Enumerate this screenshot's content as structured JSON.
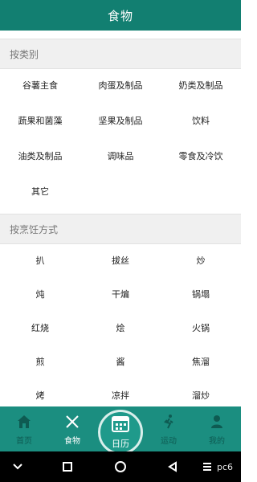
{
  "header": {
    "title": "食物"
  },
  "by_category": {
    "title": "按类别",
    "items": [
      "谷薯主食",
      "肉蛋及制品",
      "奶类及制品",
      "蔬果和菌藻",
      "坚果及制品",
      "饮料",
      "油类及制品",
      "调味品",
      "零食及冷饮",
      "其它"
    ]
  },
  "by_cooking": {
    "title": "按烹饪方式",
    "items": [
      "扒",
      "拔丝",
      "炒",
      "炖",
      "干煸",
      "锅塌",
      "红烧",
      "烩",
      "火锅",
      "煎",
      "酱",
      "焦溜",
      "烤",
      "凉拌",
      "溜炒"
    ]
  },
  "tabbar": {
    "tabs": [
      {
        "label": "首页",
        "icon": "home-icon"
      },
      {
        "label": "食物",
        "icon": "utensils-icon"
      },
      {
        "label": "日历",
        "icon": "calendar-icon"
      },
      {
        "label": "运动",
        "icon": "running-icon"
      },
      {
        "label": "我的",
        "icon": "user-icon"
      }
    ],
    "active": "食物"
  },
  "nav": {
    "icons": [
      "chevron-down-icon",
      "square-icon",
      "circle-icon",
      "back-triangle-icon",
      "menu-icon"
    ]
  },
  "watermark": "pc6",
  "colors": {
    "header": "#127f71",
    "tabbar": "#1b8e80",
    "section_bg": "#f0f0f0",
    "text": "#222222"
  }
}
